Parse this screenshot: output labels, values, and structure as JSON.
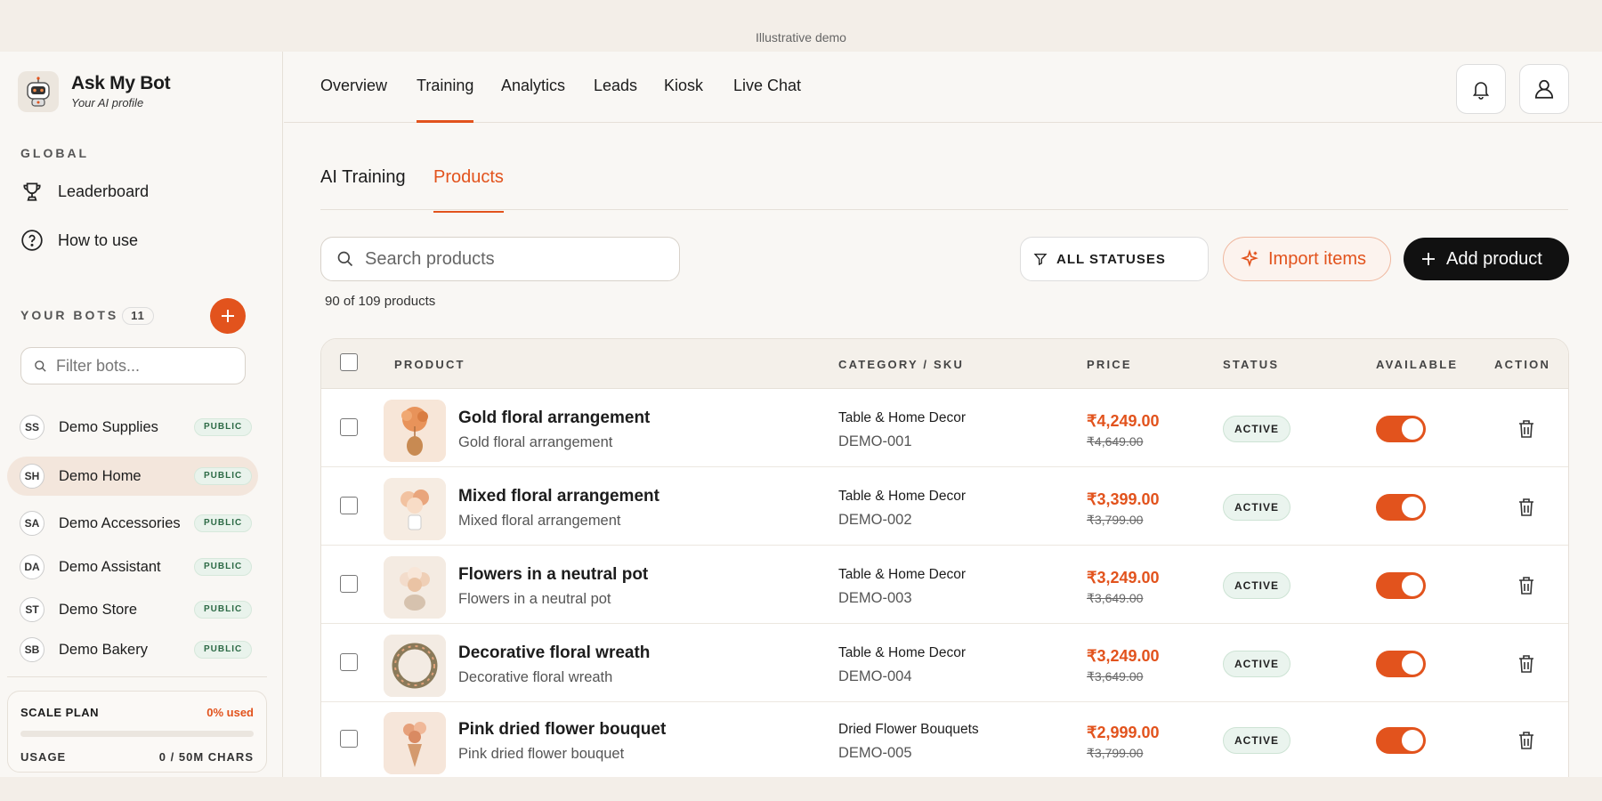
{
  "banner": "Illustrative demo",
  "brand": {
    "title": "Ask My Bot",
    "subtitle": "Your AI profile"
  },
  "sidebar": {
    "global_label": "GLOBAL",
    "links": [
      {
        "label": "Leaderboard",
        "icon": "trophy-icon"
      },
      {
        "label": "How to use",
        "icon": "help-circle-icon"
      }
    ],
    "bots_label": "YOUR BOTS",
    "bots_count": "11",
    "filter_placeholder": "Filter bots...",
    "bots": [
      {
        "initials": "SS",
        "name": "Demo Supplies",
        "badge": "PUBLIC",
        "active": false
      },
      {
        "initials": "SH",
        "name": "Demo Home",
        "badge": "PUBLIC",
        "active": true
      },
      {
        "initials": "SA",
        "name": "Demo Accessories",
        "badge": "PUBLIC",
        "active": false
      },
      {
        "initials": "DA",
        "name": "Demo Assistant",
        "badge": "PUBLIC",
        "active": false
      },
      {
        "initials": "ST",
        "name": "Demo Store",
        "badge": "PUBLIC",
        "active": false
      },
      {
        "initials": "SB",
        "name": "Demo Bakery",
        "badge": "PUBLIC",
        "active": false
      }
    ],
    "plan": {
      "name": "SCALE PLAN",
      "used": "0% used",
      "used_fraction": 0,
      "usage_label": "USAGE",
      "usage_value": "0 / 50M CHARS"
    }
  },
  "nav": {
    "tabs": [
      "Overview",
      "Training",
      "Analytics",
      "Leads",
      "Kiosk",
      "Live Chat"
    ],
    "active": "Training"
  },
  "subtabs": {
    "items": [
      "AI Training",
      "Products"
    ],
    "active": "Products"
  },
  "toolbar": {
    "search_placeholder": "Search products",
    "status_filter": "ALL STATUSES",
    "import_label": "Import items",
    "add_label": "Add product",
    "count_text": "90 of 109 products"
  },
  "table": {
    "headers": [
      "PRODUCT",
      "CATEGORY / SKU",
      "PRICE",
      "STATUS",
      "AVAILABLE",
      "ACTION"
    ],
    "rows": [
      {
        "name": "Gold floral arrangement",
        "sub": "Gold floral arrangement",
        "category": "Table & Home Decor",
        "sku": "DEMO-001",
        "price": "₹4,249.00",
        "old_price": "₹4,649.00",
        "status": "ACTIVE",
        "available": true
      },
      {
        "name": "Mixed floral arrangement",
        "sub": "Mixed floral arrangement",
        "category": "Table & Home Decor",
        "sku": "DEMO-002",
        "price": "₹3,399.00",
        "old_price": "₹3,799.00",
        "status": "ACTIVE",
        "available": true
      },
      {
        "name": "Flowers in a neutral pot",
        "sub": "Flowers in a neutral pot",
        "category": "Table & Home Decor",
        "sku": "DEMO-003",
        "price": "₹3,249.00",
        "old_price": "₹3,649.00",
        "status": "ACTIVE",
        "available": true
      },
      {
        "name": "Decorative floral wreath",
        "sub": "Decorative floral wreath",
        "category": "Table & Home Decor",
        "sku": "DEMO-004",
        "price": "₹3,249.00",
        "old_price": "₹3,649.00",
        "status": "ACTIVE",
        "available": true
      },
      {
        "name": "Pink dried flower bouquet",
        "sub": "Pink dried flower bouquet",
        "category": "Dried Flower Bouquets",
        "sku": "DEMO-005",
        "price": "₹2,999.00",
        "old_price": "₹3,799.00",
        "status": "ACTIVE",
        "available": true
      }
    ]
  },
  "colors": {
    "accent": "#e2531d",
    "dark_button": "#111111",
    "active_badge_bg": "#eaf4ee"
  }
}
